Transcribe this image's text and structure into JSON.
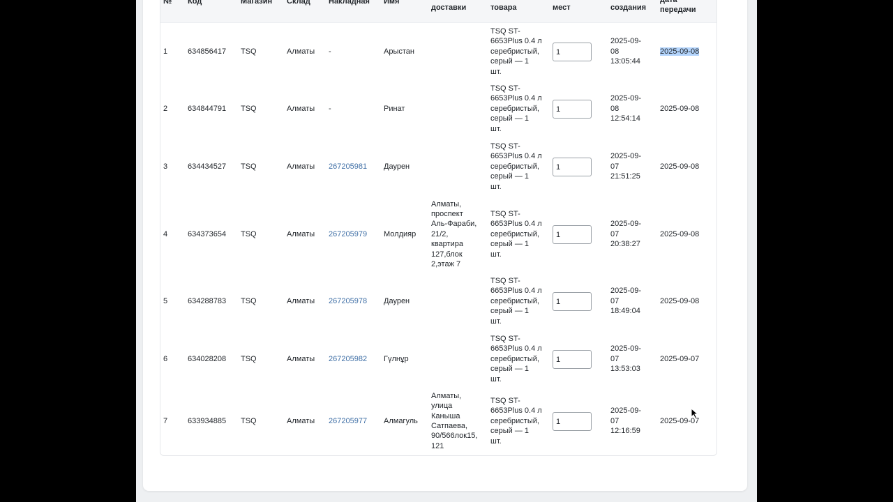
{
  "table": {
    "headers": [
      "№",
      "Код",
      "Магазин",
      "Склад",
      "Накладная",
      "Имя",
      "доставки",
      "товара",
      "мест",
      "создания",
      "дата\nпередачи"
    ],
    "rows": [
      {
        "num": "1",
        "code": "634856417",
        "shop": "TSQ",
        "warehouse": "Алматы",
        "invoice": "-",
        "name": "Арыстан",
        "address": "",
        "product": "TSQ ST-\n6653Plus 0.4 л\nсеребристый,\nсерый — 1\nшт.",
        "places": "1",
        "created": "2025-09-\n08\n13:05:44",
        "transfer_date": "2025-09-08"
      },
      {
        "num": "2",
        "code": "634844791",
        "shop": "TSQ",
        "warehouse": "Алматы",
        "invoice": "-",
        "name": "Ринат",
        "address": "",
        "product": "TSQ ST-\n6653Plus 0.4 л\nсеребристый,\nсерый — 1\nшт.",
        "places": "1",
        "created": "2025-09-\n08\n12:54:14",
        "transfer_date": "2025-09-08"
      },
      {
        "num": "3",
        "code": "634434527",
        "shop": "TSQ",
        "warehouse": "Алматы",
        "invoice": "267205981",
        "name": "Даурен",
        "address": "",
        "product": "TSQ ST-\n6653Plus 0.4 л\nсеребристый,\nсерый — 1\nшт.",
        "places": "1",
        "created": "2025-09-\n07\n21:51:25",
        "transfer_date": "2025-09-08"
      },
      {
        "num": "4",
        "code": "634373654",
        "shop": "TSQ",
        "warehouse": "Алматы",
        "invoice": "267205979",
        "name": "Молдияр",
        "address": "Алматы,\nпроспект\nАль-Фараби,\n21/2,\nквартира\n127,блок\n2,этаж 7",
        "product": "TSQ ST-\n6653Plus 0.4 л\nсеребристый,\nсерый — 1\nшт.",
        "places": "1",
        "created": "2025-09-\n07\n20:38:27",
        "transfer_date": "2025-09-08"
      },
      {
        "num": "5",
        "code": "634288783",
        "shop": "TSQ",
        "warehouse": "Алматы",
        "invoice": "267205978",
        "name": "Даурен",
        "address": "",
        "product": "TSQ ST-\n6653Plus 0.4 л\nсеребристый,\nсерый — 1\nшт.",
        "places": "1",
        "created": "2025-09-\n07\n18:49:04",
        "transfer_date": "2025-09-08"
      },
      {
        "num": "6",
        "code": "634028208",
        "shop": "TSQ",
        "warehouse": "Алматы",
        "invoice": "267205982",
        "name": "Гүлнұр",
        "address": "",
        "product": "TSQ ST-\n6653Plus 0.4 л\nсеребристый,\nсерый — 1\nшт.",
        "places": "1",
        "created": "2025-09-\n07\n13:53:03",
        "transfer_date": "2025-09-07"
      },
      {
        "num": "7",
        "code": "633934885",
        "shop": "TSQ",
        "warehouse": "Алматы",
        "invoice": "267205977",
        "name": "Алмагуль",
        "address": "Алматы,\nулица\nКаныша\nСатпаева,\n90/566лок15,\n121",
        "product": "TSQ ST-\n6653Plus 0.4 л\nсеребристый,\nсерый — 1\nшт.",
        "places": "1",
        "created": "2025-09-\n07\n12:16:59",
        "transfer_date": "2025-09-07"
      }
    ]
  },
  "colors": {
    "link": "#3f6fa6",
    "selection": "#b3d4fc",
    "header_bg": "#f5f6f8"
  },
  "icons": {
    "cursor": "mouse-pointer-icon"
  }
}
